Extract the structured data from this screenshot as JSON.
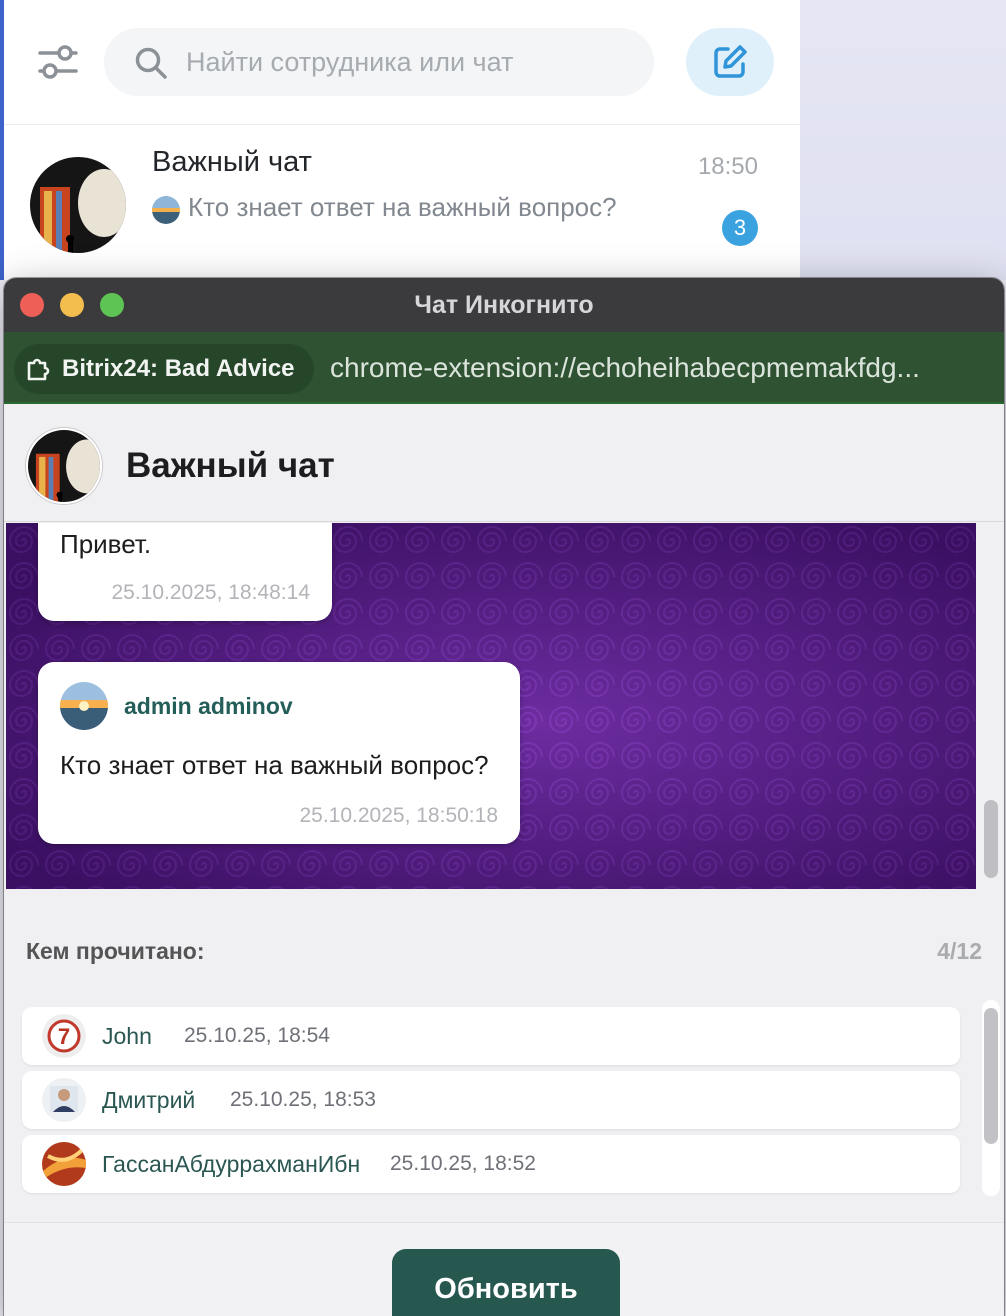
{
  "messenger": {
    "search": {
      "placeholder": "Найти сотрудника или чат"
    },
    "icons": {
      "filter": "sliders-icon",
      "search": "search-icon",
      "compose": "edit-square-icon"
    },
    "chat_list": [
      {
        "name": "Важный чат",
        "time": "18:50",
        "preview": "Кто знает ответ на важный вопрос?",
        "unread": "3"
      }
    ]
  },
  "window": {
    "title": "Чат Инкогнито",
    "extension_name": "Bitrix24: Bad Advice",
    "url": "chrome-extension://echoheihabecpmemakfdg..."
  },
  "chat": {
    "title": "Важный чат",
    "messages": [
      {
        "text": "Привет.",
        "time": "25.10.2025, 18:48:14"
      },
      {
        "author": "admin adminov",
        "text": "Кто знает ответ на важный вопрос?",
        "time": "25.10.2025, 18:50:18"
      }
    ]
  },
  "read_by": {
    "label": "Кем прочитано:",
    "count": "4/12",
    "readers": [
      {
        "name": "John",
        "time": "25.10.25, 18:54"
      },
      {
        "name": "Дмитрий",
        "time": "25.10.25, 18:53"
      },
      {
        "name": "ГассанАбдуррахманИбн",
        "time": "25.10.25, 18:52"
      }
    ]
  },
  "footer": {
    "refresh_label": "Обновить"
  },
  "colors": {
    "accent_green": "#27584f",
    "author_green": "#245e58",
    "badge_blue": "#3ba2e0",
    "chat_bg_purple": "#4a1678",
    "url_bar_green": "#2f5233"
  }
}
